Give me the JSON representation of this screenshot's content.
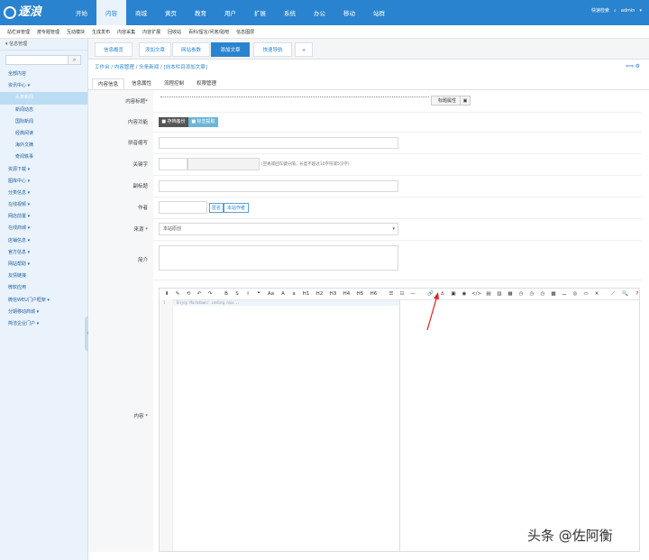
{
  "topbar": {
    "logo_text": "逐浪",
    "nav": [
      "开始",
      "内容",
      "商城",
      "黄页",
      "教育",
      "用户",
      "扩展",
      "系统",
      "办公",
      "移动",
      "站群"
    ],
    "active_nav": "内容",
    "quick_label": "快速检索",
    "user": "admin"
  },
  "subbar": {
    "items": [
      "站栏目管理",
      "按专题管理",
      "互动模块",
      "生成发布",
      "内容采集",
      "内容扩展",
      "回收站",
      "百科/留言/问答/贴吧",
      "信息图层"
    ]
  },
  "sidebar": {
    "title": "信息管理",
    "items": [
      {
        "label": "全部内容",
        "icon": "grid-icon",
        "child": false,
        "active": false
      },
      {
        "label": "资讯中心",
        "icon": "chevron-down-icon",
        "child": false,
        "active": false
      },
      {
        "label": "头条新闻",
        "icon": "",
        "child": true,
        "active": true
      },
      {
        "label": "新闻动态",
        "icon": "",
        "child": true,
        "active": false
      },
      {
        "label": "国际新闻",
        "icon": "",
        "child": true,
        "active": false
      },
      {
        "label": "经典阅读",
        "icon": "",
        "child": true,
        "active": false
      },
      {
        "label": "海外文摘",
        "icon": "",
        "child": true,
        "active": false
      },
      {
        "label": "奇闻轶事",
        "icon": "",
        "child": true,
        "active": false
      },
      {
        "label": "资源下载",
        "icon": "chevron-down-icon",
        "child": false,
        "active": false
      },
      {
        "label": "图库中心",
        "icon": "chevron-down-icon",
        "child": false,
        "active": false
      },
      {
        "label": "分类信息",
        "icon": "chevron-down-icon",
        "child": false,
        "active": false
      },
      {
        "label": "在线视频",
        "icon": "chevron-down-icon",
        "child": false,
        "active": false
      },
      {
        "label": "网店前置",
        "icon": "chevron-down-icon",
        "child": false,
        "active": false
      },
      {
        "label": "在线商城",
        "icon": "chevron-down-icon",
        "child": false,
        "active": false
      },
      {
        "label": "店铺信息",
        "icon": "chevron-down-icon",
        "child": false,
        "active": false
      },
      {
        "label": "官方信息",
        "icon": "chevron-down-icon",
        "child": false,
        "active": false
      },
      {
        "label": "网站帮助",
        "icon": "chevron-down-icon",
        "child": false,
        "active": false
      },
      {
        "label": "友情链接",
        "icon": "",
        "child": false,
        "active": false
      },
      {
        "label": "微软应用",
        "icon": "",
        "child": false,
        "active": false
      },
      {
        "label": "微信WEU门户框架",
        "icon": "chevron-down-icon",
        "child": false,
        "active": false
      },
      {
        "label": "分期移动商城",
        "icon": "chevron-down-icon",
        "child": false,
        "active": false
      },
      {
        "label": "简洁企业门户",
        "icon": "chevron-down-icon",
        "child": false,
        "active": false
      }
    ]
  },
  "page_tabs": [
    {
      "label": "信息概览",
      "active": false
    },
    {
      "label": "添加文章",
      "active": false
    },
    {
      "label": "网站参数",
      "active": false
    },
    {
      "label": "添加文章",
      "active": true
    },
    {
      "label": "快速导航",
      "active": false
    },
    {
      "label": "+",
      "active": false
    }
  ],
  "breadcrumb": "工作台 / 内容管理 / 头条新闻 / [向本栏目添加文章]",
  "form_tabs": [
    "内容信息",
    "信息属性",
    "流程控制",
    "权限管理"
  ],
  "form": {
    "title_label": "内容标题*",
    "title_btn": "标题属性",
    "function_label": "内容功能",
    "function_btn1": "存档备份",
    "function_btn2": "标志提取",
    "pinyin_label": "拼音缩写",
    "keywords_label": "关键字",
    "keywords_hint": "(空格或回车键分隔，长度不超过10字符或5汉字)",
    "subtitle_label": "副标题",
    "author_label": "作者",
    "author_btn1": "匿名",
    "author_btn2": "本站作者",
    "source_label": "来源 *",
    "source_value": "本站原创",
    "summary_label": "简介",
    "content_label": "内容 *"
  },
  "editor": {
    "toolbar": [
      "⬇",
      "✎",
      "⟲",
      "↶",
      "↷",
      "B",
      "S",
      "I",
      "❝",
      "Aa",
      "A",
      "a",
      "H1",
      "H2",
      "H3",
      "H4",
      "H5",
      "H6",
      "☰",
      "☷",
      "—",
      "🔗",
      "⚓",
      "▣",
      "◉",
      "</>",
      "▤",
      "▥",
      "▦",
      "◷",
      "◷",
      "◷",
      "▩",
      "⚊",
      "◎",
      "▭",
      "✕",
      "⟋",
      "🔍",
      "?"
    ],
    "line_number": "1",
    "placeholder": "Enjoy Markdown! coding now..."
  },
  "watermark": "头条 @佐阿衡"
}
